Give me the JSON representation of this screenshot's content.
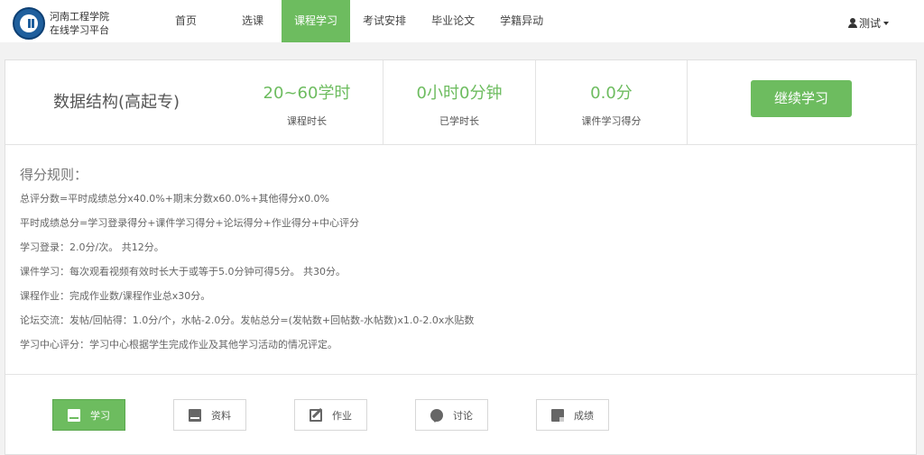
{
  "header": {
    "brand_line1": "河南工程学院",
    "brand_line2": "在线学习平台",
    "nav": [
      "首页",
      "选课",
      "课程学习",
      "考试安排",
      "毕业论文",
      "学籍异动"
    ],
    "user": "测试"
  },
  "course": {
    "title": "数据结构(高起专)",
    "stats": [
      {
        "value": "20~60学时",
        "label": "课程时长"
      },
      {
        "value": "0小时0分钟",
        "label": "已学时长"
      },
      {
        "value": "0.0分",
        "label": "课件学习得分"
      }
    ],
    "continue_label": "继续学习"
  },
  "rules": {
    "title": "得分规则：",
    "lines": [
      "总评分数=平时成绩总分x40.0%+期末分数x60.0%+其他得分x0.0%",
      "平时成绩总分=学习登录得分+课件学习得分+论坛得分+作业得分+中心评分",
      "学习登录：2.0分/次。 共12分。",
      "课件学习：每次观看视频有效时长大于或等于5.0分钟可得5分。 共30分。",
      "课程作业：完成作业数/课程作业总x30分。",
      "论坛交流：发帖/回帖得：1.0分/个，水帖-2.0分。发帖总分=(发帖数+回帖数-水帖数)x1.0-2.0x水贴数",
      "学习中心评分：学习中心根据学生完成作业及其他学习活动的情况评定。"
    ]
  },
  "tabs": [
    "学习",
    "资料",
    "作业",
    "讨论",
    "成绩"
  ],
  "colors": {
    "accent": "#6dbc5f"
  }
}
